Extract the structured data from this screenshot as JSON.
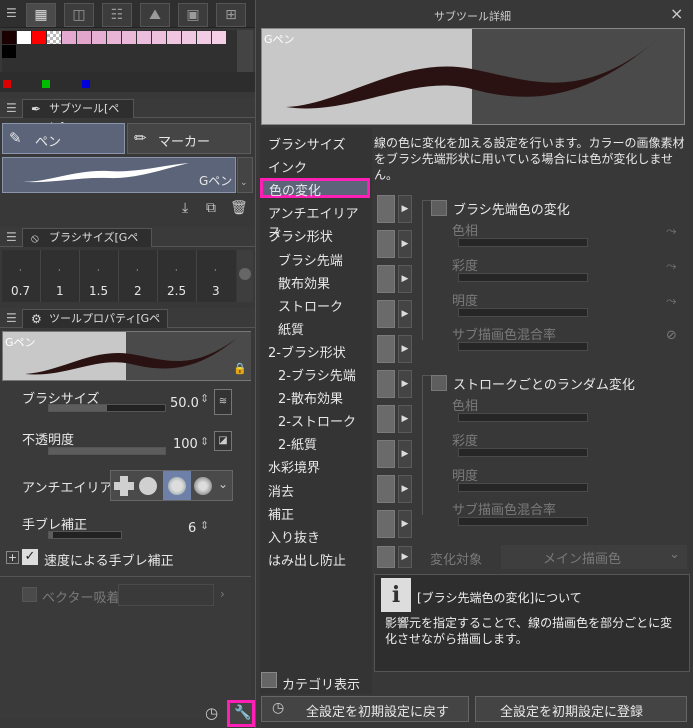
{
  "left": {
    "sub_tool_tab": "サブツール[ペン]",
    "sub_tools": [
      {
        "label": "ペン",
        "selected": true
      },
      {
        "label": "マーカー",
        "selected": false
      }
    ],
    "brush_preview_name": "Gペン",
    "brush_size_tab": "ブラシサイズ[Gペン]",
    "brush_sizes": [
      "0.7",
      "1",
      "1.5",
      "2",
      "2.5",
      "3"
    ],
    "tool_property_tab": "ツールプロパティ[Gペン]",
    "tool_preview_name": "Gペン",
    "props": {
      "brush_size": {
        "label": "ブラシサイズ",
        "value": "50.0"
      },
      "opacity": {
        "label": "不透明度",
        "value": "100"
      },
      "antialias": {
        "label": "アンチエイリアス"
      },
      "stabilization": {
        "label": "手ブレ補正",
        "value": "6"
      },
      "speed_stabilization": {
        "label": "速度による手ブレ補正",
        "checked": true
      },
      "vector_snap": {
        "label": "ベクター吸着"
      }
    },
    "plus_label": "+"
  },
  "dialog": {
    "title": "サブツール詳細",
    "close": "×",
    "preview_name": "Gペン",
    "categories": [
      {
        "label": "ブラシサイズ",
        "indent": 0
      },
      {
        "label": "インク",
        "indent": 0
      },
      {
        "label": "色の変化",
        "indent": 0,
        "selected": true
      },
      {
        "label": "アンチエイリアス",
        "indent": 0
      },
      {
        "label": "ブラシ形状",
        "indent": 0
      },
      {
        "label": "ブラシ先端",
        "indent": 1
      },
      {
        "label": "散布効果",
        "indent": 1
      },
      {
        "label": "ストローク",
        "indent": 1
      },
      {
        "label": "紙質",
        "indent": 1
      },
      {
        "label": "2-ブラシ形状",
        "indent": 0
      },
      {
        "label": "2-ブラシ先端",
        "indent": 1
      },
      {
        "label": "2-散布効果",
        "indent": 1
      },
      {
        "label": "2-ストローク",
        "indent": 1
      },
      {
        "label": "2-紙質",
        "indent": 1
      },
      {
        "label": "水彩境界",
        "indent": 0
      },
      {
        "label": "消去",
        "indent": 0
      },
      {
        "label": "補正",
        "indent": 0
      },
      {
        "label": "入り抜き",
        "indent": 0
      },
      {
        "label": "はみ出し防止",
        "indent": 0
      }
    ],
    "category_display": "カテゴリ表示",
    "description": "線の色に変化を加える設定を行います。カラーの画像素材をブラシ先端形状に用いている場合には色が変化しません。",
    "tip_color_change": {
      "label": "ブラシ先端色の変化",
      "items": [
        "色相",
        "彩度",
        "明度",
        "サブ描画色混合率"
      ]
    },
    "stroke_random": {
      "label": "ストロークごとのランダム変化",
      "items": [
        "色相",
        "彩度",
        "明度",
        "サブ描画色混合率"
      ]
    },
    "change_target": {
      "label": "変化対象",
      "value": "メイン描画色"
    },
    "info": {
      "title": "[ブラシ先端色の変化]について",
      "body": "影響元を指定することで、線の描画色を部分ごとに変化させながら描画します。",
      "icon": "i"
    },
    "reset_all": "全設定を初期設定に戻す",
    "register_all": "全設定を初期設定に登録"
  },
  "colors": {
    "highlight": "#ff1fb4",
    "selected_bg": "#5b6478",
    "stroke": "#2a1212"
  }
}
